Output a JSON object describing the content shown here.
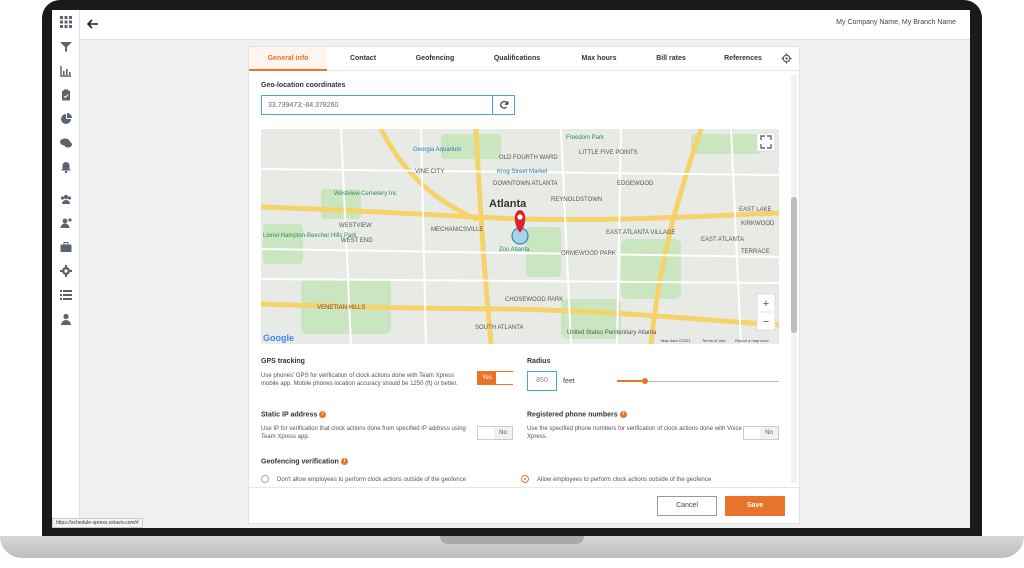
{
  "header": {
    "company": "My Company Name, My Branch Name"
  },
  "sidebar": {
    "icons": [
      "grid-icon",
      "filter-icon",
      "chart-icon",
      "clipboard-icon",
      "pie-icon",
      "chat-icon",
      "bell-icon",
      "users-icon",
      "user-pin-icon",
      "briefcase-icon",
      "gear-icon",
      "list-icon",
      "person-icon"
    ]
  },
  "tabs": [
    {
      "label": "General info",
      "active": true
    },
    {
      "label": "Contact"
    },
    {
      "label": "Geofencing"
    },
    {
      "label": "Qualifications"
    },
    {
      "label": "Max hours"
    },
    {
      "label": "Bill rates"
    },
    {
      "label": "References"
    }
  ],
  "geo": {
    "title": "Geo-location coordinates",
    "value": "33.739473;-84.378260"
  },
  "map": {
    "city": "Atlanta",
    "places": [
      "Georgia Aquarium",
      "Freedom Park",
      "LITTLE FIVE POINTS",
      "OLD FOURTH WARD",
      "VINE CITY",
      "Krog Street Market",
      "DOWNTOWN ATLANTA",
      "EDGEWOOD",
      "REYNOLDSTOWN",
      "Westview Cemetery Inc",
      "MECHANICSVILLE",
      "WESTVIEW",
      "WEST END",
      "Zoo Atlanta",
      "EAST ATLANTA VILLAGE",
      "ORMEWOOD PARK",
      "EAST LAKE",
      "KIRKWOOD",
      "Lionel Hampton-Beecher Hills Park",
      "VENETIAN HILLS",
      "CHOSEWOOD PARK",
      "SOUTH ATLANTA",
      "United States Penitentiary Atlanta",
      "EAST ATLANTA",
      "TERRACE"
    ],
    "logo": "Google",
    "attribution": [
      "Map data ©2021",
      "Terms of Use",
      "Report a map error"
    ],
    "zoom_in": "+",
    "zoom_out": "−"
  },
  "gps": {
    "title": "GPS tracking",
    "desc": "Use phones' GPS for verification of clock actions done with Team Xpress mobile app. Mobile phones location accuracy should be 1250 (ft) or better.",
    "toggle": "Yes"
  },
  "radius": {
    "title": "Radius",
    "value": "850",
    "unit": "feet",
    "slider_fraction": 0.17
  },
  "static_ip": {
    "title": "Static IP address",
    "desc": "Use IP for verification that clock actions done from specified IP address using Team Xpress app.",
    "toggle": "No"
  },
  "phones": {
    "title": "Registered phone numbers",
    "desc": "Use the specified phone numbers for verification of clock actions done with Voice Xpress.",
    "toggle": "No"
  },
  "geofence": {
    "title": "Geofencing verification",
    "option1": "Don't allow employees to perform clock actions outside of the geofence",
    "option2": "Allow employees to perform clock actions outside of the geofence"
  },
  "footer": {
    "cancel": "Cancel",
    "save": "Save"
  },
  "status_url": "https://schedule-xpress.celaviv.com/#",
  "colors": {
    "accent": "#e8732a",
    "focus": "#4aa6d6"
  }
}
